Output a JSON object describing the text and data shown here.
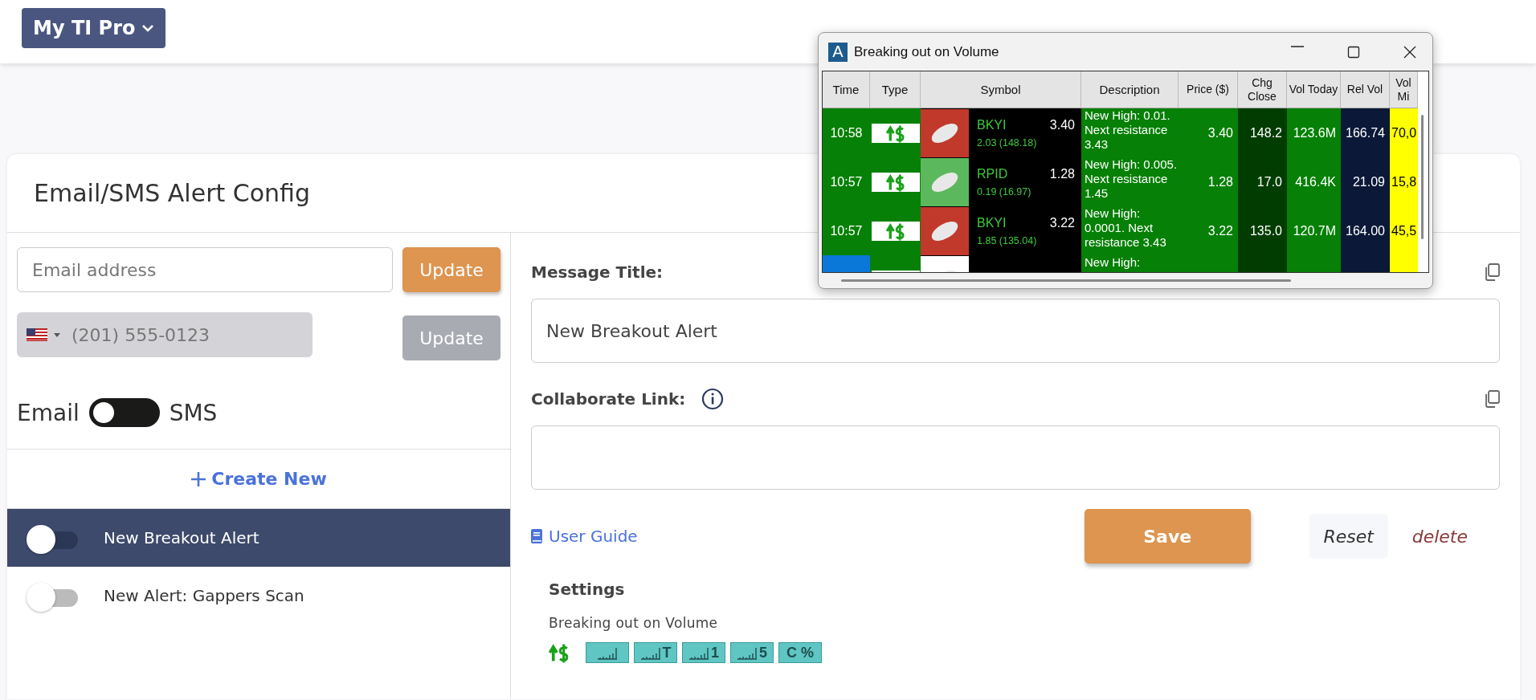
{
  "top_bar": {
    "menu_button": "My TI Pro"
  },
  "card": {
    "title": "Email/SMS Alert Config"
  },
  "contact": {
    "email_placeholder": "Email address",
    "email_button": "Update",
    "phone_placeholder": "(201) 555-0123",
    "phone_button": "Update",
    "phone_disabled": true
  },
  "channel_toggle": {
    "left_label": "Email",
    "right_label": "SMS",
    "sms_selected": false
  },
  "create_new": "Create New",
  "alerts": [
    {
      "name": "New Breakout Alert",
      "selected": true,
      "on": false
    },
    {
      "name": "New Alert: Gappers Scan",
      "selected": false,
      "on": false
    }
  ],
  "form": {
    "message_title_label": "Message Title:",
    "message_title_value": "New Breakout Alert",
    "collaborate_label": "Collaborate Link:",
    "user_guide": "User Guide",
    "save": "Save",
    "reset": "Reset",
    "delete": "delete"
  },
  "settings": {
    "heading": "Settings",
    "strategy": "Breaking out on Volume",
    "filters": [
      {
        "kind": "alert"
      },
      {
        "kind": "bars"
      },
      {
        "kind": "bars",
        "label": "T"
      },
      {
        "kind": "bars",
        "label": "1"
      },
      {
        "kind": "bars",
        "label": "5"
      },
      {
        "kind": "text",
        "label": "C %"
      }
    ]
  },
  "window": {
    "icon_letter": "A",
    "title": "Breaking out on Volume",
    "columns": [
      "Time",
      "Type",
      "Symbol",
      "Description",
      "Price ($)",
      "Chg Close",
      "Vol Today",
      "Rel Vol",
      "Vol Mi"
    ],
    "rows": [
      {
        "time": "10:58",
        "color": "#c0392b",
        "symbol": "BKYI",
        "last": "3.40",
        "change": "2.03 (148.18)",
        "description": "New High: 0.01. Next resistance 3.43",
        "price": "3.40",
        "chg_close": "148.2",
        "vol_today": "123.6M",
        "rel_vol": "166.74",
        "vol_min": "70,0",
        "selected": false
      },
      {
        "time": "10:57",
        "color": "#5cb85c",
        "symbol": "RPID",
        "last": "1.28",
        "change": "0.19 (16.97)",
        "description": "New High: 0.005. Next resistance 1.45",
        "price": "1.28",
        "chg_close": "17.0",
        "vol_today": "416.4K",
        "rel_vol": "21.09",
        "vol_min": "15,8",
        "selected": false
      },
      {
        "time": "10:57",
        "color": "#c0392b",
        "symbol": "BKYI",
        "last": "3.22",
        "change": "1.85 (135.04)",
        "description": "New High: 0.0001. Next resistance 3.43",
        "price": "3.22",
        "chg_close": "135.0",
        "vol_today": "120.7M",
        "rel_vol": "164.00",
        "vol_min": "45,5",
        "selected": false
      },
      {
        "color": "#ffffff",
        "description": "New High:",
        "selected": true
      }
    ]
  }
}
